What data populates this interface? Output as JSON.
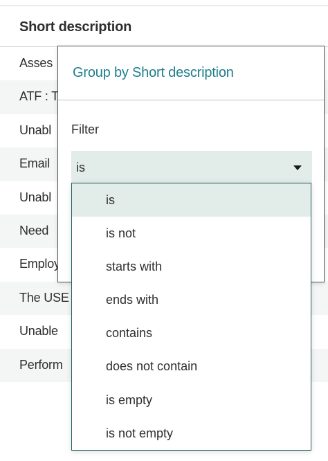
{
  "table": {
    "header": "Short description",
    "rows": [
      "Asses",
      "ATF : T",
      "Unabl",
      "Email",
      "Unabl",
      "Need",
      "Employ",
      "The USE",
      "Unable",
      "Perform"
    ]
  },
  "group_panel": {
    "title": "Group by Short description",
    "filter_label": "Filter",
    "select_value": "is",
    "caret_icon": "caret-down-icon"
  },
  "dropdown": {
    "selected": "is",
    "options": [
      "is",
      "is not",
      "starts with",
      "ends with",
      "contains",
      "does not contain",
      "is empty",
      "is not empty"
    ]
  },
  "colors": {
    "accent": "#1f7f8c",
    "select_bg": "#e2ece9",
    "row_alt": "#f4f5f5"
  }
}
